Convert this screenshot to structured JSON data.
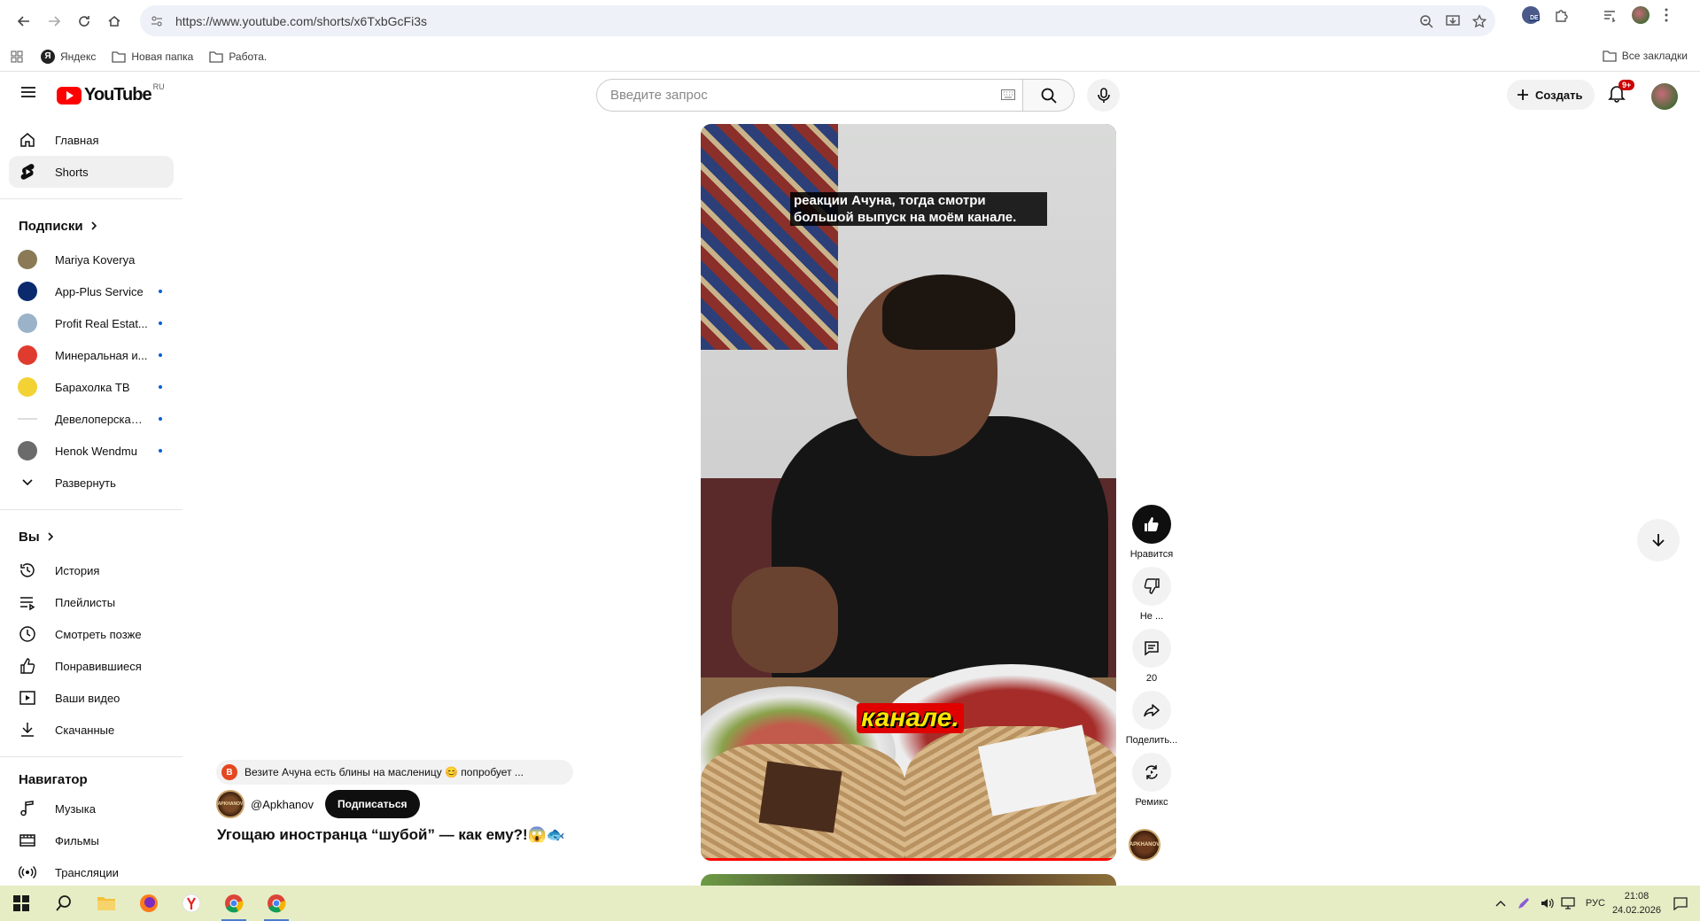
{
  "browser": {
    "url": "https://www.youtube.com/shorts/x6TxbGcFi3s",
    "ext_badge": "DE"
  },
  "bookmarks": {
    "items": [
      {
        "label": "Яндекс",
        "icon": "yandex-icon"
      },
      {
        "label": "Новая папка",
        "icon": "folder-icon"
      },
      {
        "label": "Работа.",
        "icon": "folder-icon"
      }
    ],
    "all_label": "Все закладки"
  },
  "header": {
    "logo_text": "YouTube",
    "logo_region": "RU",
    "search_placeholder": "Введите запрос",
    "create_label": "Создать",
    "notifications_badge": "9+"
  },
  "sidebar": {
    "main": [
      {
        "label": "Главная",
        "icon": "home-icon"
      },
      {
        "label": "Shorts",
        "icon": "shorts-icon",
        "active": true
      }
    ],
    "subs_title": "Подписки",
    "subscriptions": [
      {
        "name": "Mariya Koverya",
        "new": false,
        "color": "#8a7a55"
      },
      {
        "name": "App-Plus Service",
        "new": true,
        "color": "#0b2a6e"
      },
      {
        "name": "Profit Real Estat...",
        "new": true,
        "color": "#9bb3c9"
      },
      {
        "name": "Минеральная и...",
        "new": true,
        "color": "#e03b2f"
      },
      {
        "name": "Барахолка ТВ",
        "new": true,
        "color": "#f3d234"
      },
      {
        "name": "Девелоперская ...",
        "new": true,
        "color": "#dddddd"
      },
      {
        "name": "Henok Wendmu",
        "new": true,
        "color": "#6b6b6b"
      }
    ],
    "expand_label": "Развернуть",
    "you_title": "Вы",
    "you_items": [
      {
        "label": "История",
        "icon": "history-icon"
      },
      {
        "label": "Плейлисты",
        "icon": "playlists-icon"
      },
      {
        "label": "Смотреть позже",
        "icon": "clock-icon"
      },
      {
        "label": "Понравившиеся",
        "icon": "thumbs-up-icon"
      },
      {
        "label": "Ваши видео",
        "icon": "your-videos-icon"
      },
      {
        "label": "Скачанные",
        "icon": "download-icon"
      }
    ],
    "nav_title": "Навигатор",
    "nav_items": [
      {
        "label": "Музыка",
        "icon": "music-icon"
      },
      {
        "label": "Фильмы",
        "icon": "film-icon"
      },
      {
        "label": "Трансляции",
        "icon": "live-icon"
      }
    ]
  },
  "video": {
    "caption_top": "реакции Ачуна, тогда смотри большой выпуск на моём канале.",
    "caption_big": "канале.",
    "suggest_badge": "В",
    "suggest_text": "Везите Ачуна есть блины на масленицу 😊 попробует ...",
    "channel_handle": "@Apkhanov",
    "channel_logo_text": "APKHANOV",
    "subscribe_label": "Подписаться",
    "title": "Угощаю иностранца “шубой” — как ему?!😱🐟"
  },
  "actions": {
    "like_label": "Нравится",
    "dislike_label": "Не ...",
    "comments_count": "20",
    "share_label": "Поделить...",
    "remix_label": "Ремикс"
  },
  "taskbar": {
    "lang": "РУС",
    "time": "21:08",
    "date": "24.02.2026"
  }
}
